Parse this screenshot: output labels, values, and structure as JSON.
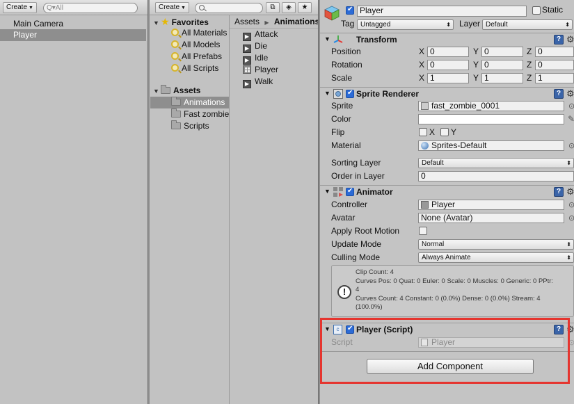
{
  "hierarchy": {
    "create_label": "Create",
    "search_placeholder": "Q▾All",
    "items": [
      "Main Camera",
      "Player"
    ],
    "selected": "Player"
  },
  "project": {
    "create_label": "Create",
    "favorites": {
      "label": "Favorites",
      "items": [
        "All Materials",
        "All Models",
        "All Prefabs",
        "All Scripts"
      ]
    },
    "assets": {
      "label": "Assets",
      "folders": [
        "Animations",
        "Fast zombie",
        "Scripts"
      ],
      "selected": "Animations"
    },
    "breadcrumb": [
      "Assets",
      "Animations"
    ],
    "files": [
      {
        "name": "Attack",
        "icon": "animation-clip-icon"
      },
      {
        "name": "Die",
        "icon": "animation-clip-icon"
      },
      {
        "name": "Idle",
        "icon": "animation-clip-icon"
      },
      {
        "name": "Player",
        "icon": "animator-controller-icon"
      },
      {
        "name": "Walk",
        "icon": "animation-clip-icon"
      }
    ]
  },
  "inspector": {
    "object_name": "Player",
    "static_label": "Static",
    "tag_label": "Tag",
    "tag_value": "Untagged",
    "layer_label": "Layer",
    "layer_value": "Default",
    "transform": {
      "title": "Transform",
      "position_label": "Position",
      "rotation_label": "Rotation",
      "scale_label": "Scale",
      "axis_x": "X",
      "axis_y": "Y",
      "axis_z": "Z",
      "position": [
        "0",
        "0",
        "0"
      ],
      "rotation": [
        "0",
        "0",
        "0"
      ],
      "scale": [
        "1",
        "1",
        "1"
      ]
    },
    "sprite_renderer": {
      "title": "Sprite Renderer",
      "sprite_label": "Sprite",
      "sprite_value": "fast_zombie_0001",
      "color_label": "Color",
      "flip_label": "Flip",
      "flip_x": "X",
      "flip_y": "Y",
      "material_label": "Material",
      "material_value": "Sprites-Default",
      "sorting_layer_label": "Sorting Layer",
      "sorting_layer_value": "Default",
      "order_label": "Order in Layer",
      "order_value": "0"
    },
    "animator": {
      "title": "Animator",
      "controller_label": "Controller",
      "controller_value": "Player",
      "avatar_label": "Avatar",
      "avatar_value": "None (Avatar)",
      "root_motion_label": "Apply Root Motion",
      "update_mode_label": "Update Mode",
      "update_mode_value": "Normal",
      "culling_mode_label": "Culling Mode",
      "culling_mode_value": "Always Animate",
      "info": "Clip Count: 4\nCurves Pos: 0 Quat: 0 Euler: 0 Scale: 0 Muscles: 0 Generic: 0 PPtr:\n4\nCurves Count: 4 Constant: 0 (0.0%) Dense: 0 (0.0%) Stream: 4\n(100.0%)"
    },
    "player_script": {
      "title": "Player (Script)",
      "script_label": "Script",
      "script_value": "Player"
    },
    "add_component_label": "Add Component"
  },
  "colors": {
    "highlight": "#e5352f",
    "selection": "#8e8e8e",
    "panel_bg": "#c2c2c2"
  }
}
